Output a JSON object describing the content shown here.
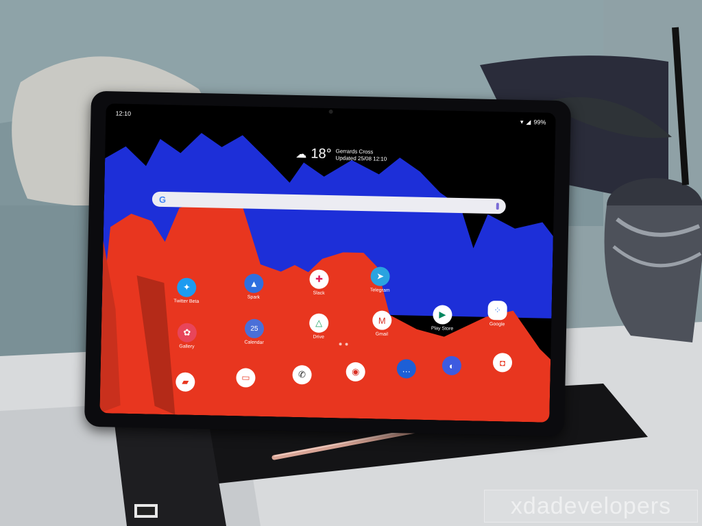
{
  "status_bar": {
    "time": "12:10",
    "battery": "99%"
  },
  "weather": {
    "temperature": "18°",
    "location": "Gerrards Cross",
    "updated": "Updated 25/08 12:10"
  },
  "search": {
    "logo": "G"
  },
  "apps": [
    {
      "label": "Twitter Beta",
      "icon": "twitter-icon",
      "color": "#1d9bf0"
    },
    {
      "label": "Spark",
      "icon": "spark-icon",
      "color": "#2f6fdf"
    },
    {
      "label": "Slack",
      "icon": "slack-icon",
      "color": "#ffffff"
    },
    {
      "label": "Telegram",
      "icon": "telegram-icon",
      "color": "#2aa3e0"
    },
    {
      "label": "Gallery",
      "icon": "gallery-icon",
      "color": "#e8455a"
    },
    {
      "label": "Calendar",
      "icon": "calendar-icon",
      "color": "#4a6fd8",
      "text": "25"
    },
    {
      "label": "Drive",
      "icon": "drive-icon",
      "color": "#ffffff"
    },
    {
      "label": "Gmail",
      "icon": "gmail-icon",
      "color": "#ffffff"
    },
    {
      "label": "Play Store",
      "icon": "play-store-icon",
      "color": "#ffffff"
    },
    {
      "label": "Google",
      "icon": "google-folder-icon",
      "color": "#ffffff"
    }
  ],
  "watermark": "xdadevelopers",
  "colors": {
    "wallpaper_red": "#e8361f",
    "wallpaper_blue": "#1d2fd8",
    "bezel": "#0b0b0e"
  }
}
